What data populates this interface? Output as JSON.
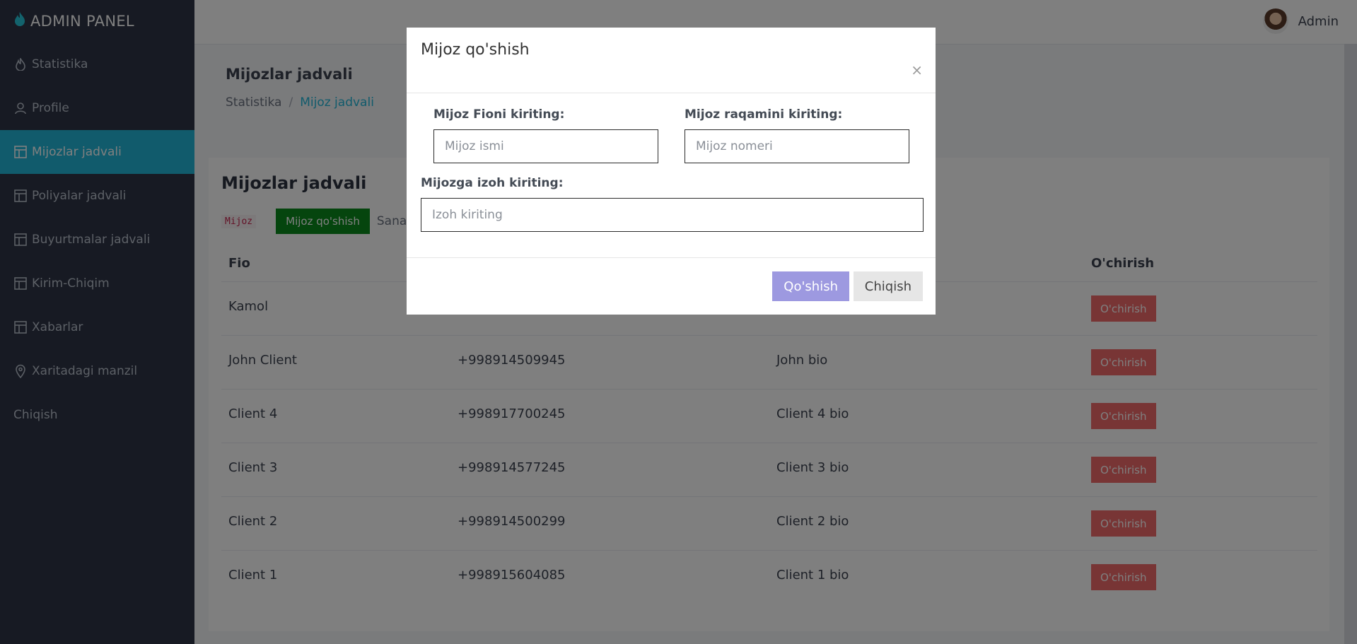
{
  "sidebar": {
    "brand": "ADMIN PANEL",
    "brand_icon": "flame-icon",
    "items": [
      {
        "label": "Statistika",
        "icon": "flame-icon"
      },
      {
        "label": "Profile",
        "icon": "user-icon"
      },
      {
        "label": "Mijozlar jadvali",
        "icon": "table-icon",
        "active": true
      },
      {
        "label": "Poliyalar jadvali",
        "icon": "table-icon"
      },
      {
        "label": "Buyurtmalar jadvali",
        "icon": "table-icon"
      },
      {
        "label": "Kirim-Chiqim",
        "icon": "table-icon"
      },
      {
        "label": "Xabarlar",
        "icon": "table-icon"
      },
      {
        "label": "Xaritadagi manzil",
        "icon": "location-pin-icon"
      },
      {
        "label": "Chiqish",
        "icon": ""
      }
    ]
  },
  "topbar": {
    "user_name": "Admin",
    "avatar_icon": "avatar"
  },
  "page": {
    "title": "Mijozlar jadvali",
    "breadcrumb": {
      "home": "Statistika",
      "separator": "/",
      "current": "Mijoz jadvali"
    }
  },
  "card": {
    "title": "Mijozlar jadvali",
    "code_tag": "Mijoz",
    "add_button": "Mijoz qo'shish",
    "sanar_text": "Sanar"
  },
  "table": {
    "headers": [
      "Fio",
      "",
      "",
      "O'chirish"
    ],
    "rows": [
      {
        "fio": "Kamol",
        "phone": "",
        "bio": "",
        "action": "O'chirish"
      },
      {
        "fio": "John Client",
        "phone": "+998914509945",
        "bio": "John bio",
        "action": "O'chirish"
      },
      {
        "fio": "Client 4",
        "phone": "+998917700245",
        "bio": "Client 4 bio",
        "action": "O'chirish"
      },
      {
        "fio": "Client 3",
        "phone": "+998914577245",
        "bio": "Client 3 bio",
        "action": "O'chirish"
      },
      {
        "fio": "Client 2",
        "phone": "+998914500299",
        "bio": "Client 2 bio",
        "action": "O'chirish"
      },
      {
        "fio": "Client 1",
        "phone": "+998915604085",
        "bio": "Client 1 bio",
        "action": "O'chirish"
      }
    ]
  },
  "modal": {
    "title": "Mijoz qo'shish",
    "close": "×",
    "name_label": "Mijoz Fioni kiriting:",
    "name_placeholder": "Mijoz ismi",
    "phone_label": "Mijoz raqamini kiriting:",
    "phone_placeholder": "Mijoz nomeri",
    "note_label": "Mijozga izoh kiriting:",
    "note_placeholder": "Izoh kiriting",
    "submit": "Qo'shish",
    "exit": "Chiqish"
  },
  "colors": {
    "sidebar_bg": "#2f3546",
    "active": "#23b7d9",
    "add_button": "#0b8a1d",
    "delete_button": "#f16b6b",
    "submit_button": "#9d99e0"
  }
}
